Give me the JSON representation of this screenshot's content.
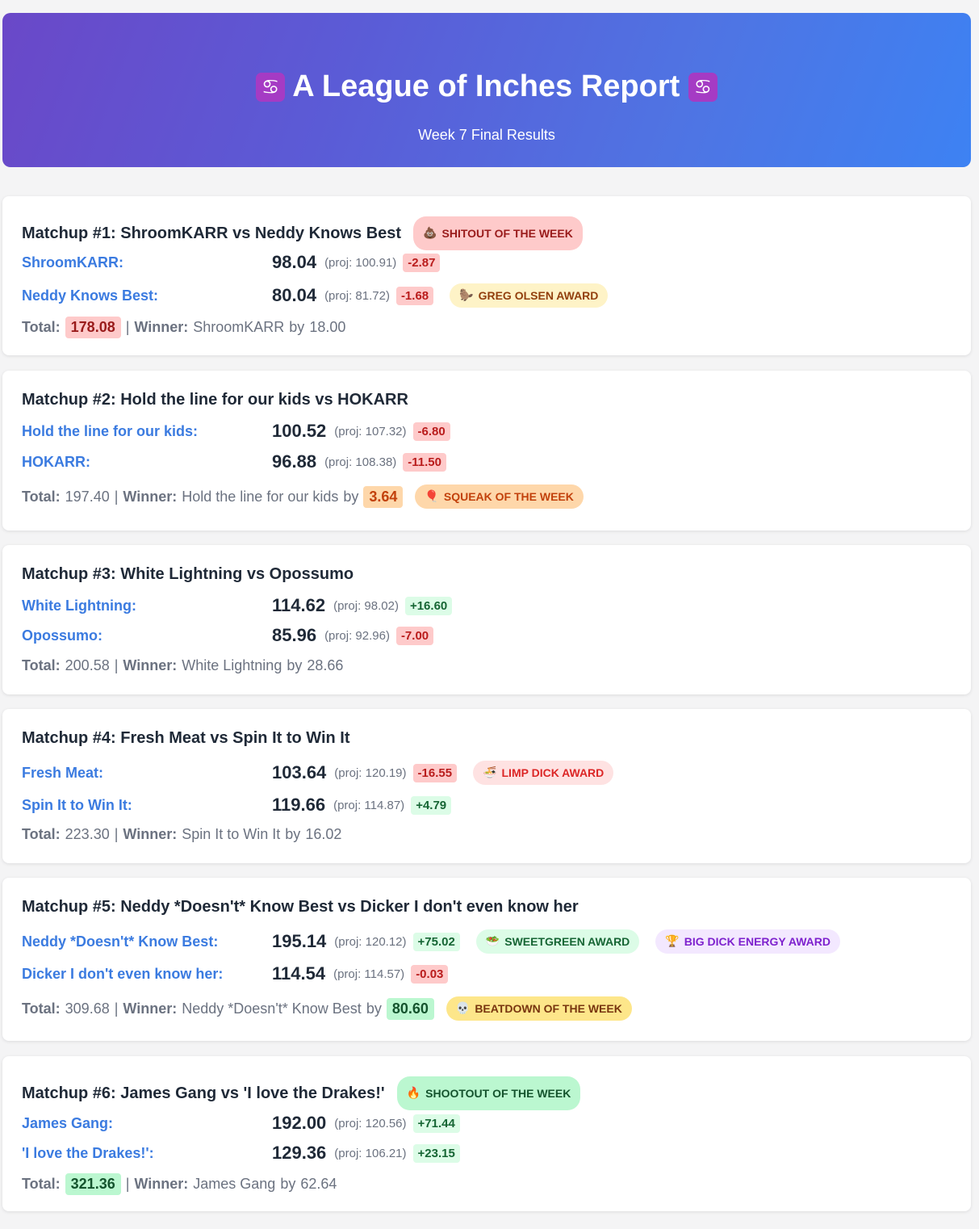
{
  "header": {
    "zodiac_icon": "♋",
    "title": "A League of Inches Report",
    "subtitle": "Week 7 Final Results"
  },
  "labels": {
    "total": "Total:",
    "separator": "|",
    "winner": "Winner:",
    "by": "by"
  },
  "matchups": [
    {
      "title": "Matchup #1: ShroomKARR vs Neddy Knows Best",
      "title_badge": {
        "icon": "💩",
        "label": "SHITOUT OF THE WEEK"
      },
      "teams": [
        {
          "name": "ShroomKARR:",
          "score": "98.04",
          "proj": "(proj: 100.91)",
          "diff": "-2.87"
        },
        {
          "name": "Neddy Knows Best:",
          "score": "80.04",
          "proj": "(proj: 81.72)",
          "diff": "-1.68",
          "badge": {
            "icon": "🦫",
            "label": "GREG OLSEN AWARD"
          }
        }
      ],
      "total": "178.08",
      "winner": "ShroomKARR",
      "margin": "18.00"
    },
    {
      "title": "Matchup #2: Hold the line for our kids vs HOKARR",
      "teams": [
        {
          "name": "Hold the line for our kids:",
          "score": "100.52",
          "proj": "(proj: 107.32)",
          "diff": "-6.80"
        },
        {
          "name": "HOKARR:",
          "score": "96.88",
          "proj": "(proj: 108.38)",
          "diff": "-11.50"
        }
      ],
      "total": "197.40",
      "winner": "Hold the line for our kids",
      "margin": "3.64",
      "total_badge": {
        "icon": "🎈",
        "label": "SQUEAK OF THE WEEK"
      }
    },
    {
      "title": "Matchup #3: White Lightning vs Opossumo",
      "teams": [
        {
          "name": "White Lightning:",
          "score": "114.62",
          "proj": "(proj: 98.02)",
          "diff": "+16.60"
        },
        {
          "name": "Opossumo:",
          "score": "85.96",
          "proj": "(proj: 92.96)",
          "diff": "-7.00"
        }
      ],
      "total": "200.58",
      "winner": "White Lightning",
      "margin": "28.66"
    },
    {
      "title": "Matchup #4: Fresh Meat vs Spin It to Win It",
      "teams": [
        {
          "name": "Fresh Meat:",
          "score": "103.64",
          "proj": "(proj: 120.19)",
          "diff": "-16.55",
          "badge": {
            "icon": "🍜",
            "label": "LIMP DICK AWARD"
          }
        },
        {
          "name": "Spin It to Win It:",
          "score": "119.66",
          "proj": "(proj: 114.87)",
          "diff": "+4.79"
        }
      ],
      "total": "223.30",
      "winner": "Spin It to Win It",
      "margin": "16.02"
    },
    {
      "title": "Matchup #5: Neddy *Doesn't* Know Best vs Dicker I don't even know her",
      "teams": [
        {
          "name": "Neddy *Doesn't* Know Best:",
          "score": "195.14",
          "proj": "(proj: 120.12)",
          "diff": "+75.02",
          "badge": {
            "icon": "🥗",
            "label": "SWEETGREEN AWARD"
          },
          "badge2": {
            "icon": "🏆",
            "label": "BIG DICK ENERGY AWARD"
          }
        },
        {
          "name": "Dicker I don't even know her:",
          "score": "114.54",
          "proj": "(proj: 114.57)",
          "diff": "-0.03"
        }
      ],
      "total": "309.68",
      "winner": "Neddy *Doesn't* Know Best",
      "margin": "80.60",
      "total_badge": {
        "icon": "💀",
        "label": "BEATDOWN OF THE WEEK"
      }
    },
    {
      "title": "Matchup #6: James Gang vs 'I love the Drakes!'",
      "title_badge": {
        "icon": "🔥",
        "label": "SHOOTOUT OF THE WEEK"
      },
      "teams": [
        {
          "name": "James Gang:",
          "score": "192.00",
          "proj": "(proj: 120.56)",
          "diff": "+71.44"
        },
        {
          "name": "'I love the Drakes!':",
          "score": "129.36",
          "proj": "(proj: 106.21)",
          "diff": "+23.15"
        }
      ],
      "total": "321.36",
      "winner": "James Gang",
      "margin": "62.64"
    }
  ]
}
